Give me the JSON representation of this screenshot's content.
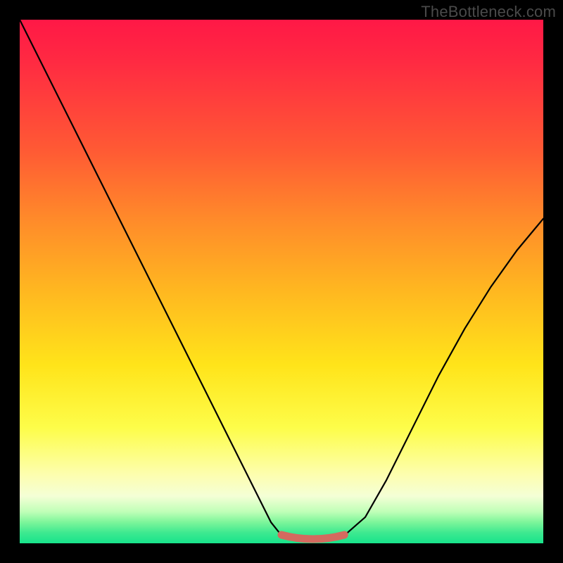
{
  "watermark": {
    "text": "TheBottleneck.com"
  },
  "colors": {
    "frame_bg": "#000000",
    "curve": "#000000",
    "trough_marker": "#d46a5f"
  },
  "chart_data": {
    "type": "line",
    "title": "",
    "xlabel": "",
    "ylabel": "",
    "xlim": [
      0,
      100
    ],
    "ylim": [
      0,
      100
    ],
    "series": [
      {
        "name": "bottleneck-curve",
        "x": [
          0,
          5,
          10,
          15,
          20,
          25,
          30,
          35,
          40,
          45,
          48,
          50,
          53,
          56,
          59,
          62,
          66,
          70,
          75,
          80,
          85,
          90,
          95,
          100
        ],
        "y": [
          100,
          90,
          80,
          70,
          60,
          50,
          40,
          30,
          20,
          10,
          4,
          1.5,
          0.7,
          0.6,
          0.7,
          1.5,
          5,
          12,
          22,
          32,
          41,
          49,
          56,
          62
        ]
      }
    ],
    "trough_marker": {
      "x_start": 50,
      "x_end": 62,
      "y": 0.8
    },
    "background_gradient": {
      "orientation": "vertical",
      "top": "#ff1846",
      "bottom": "#17e38b"
    }
  }
}
